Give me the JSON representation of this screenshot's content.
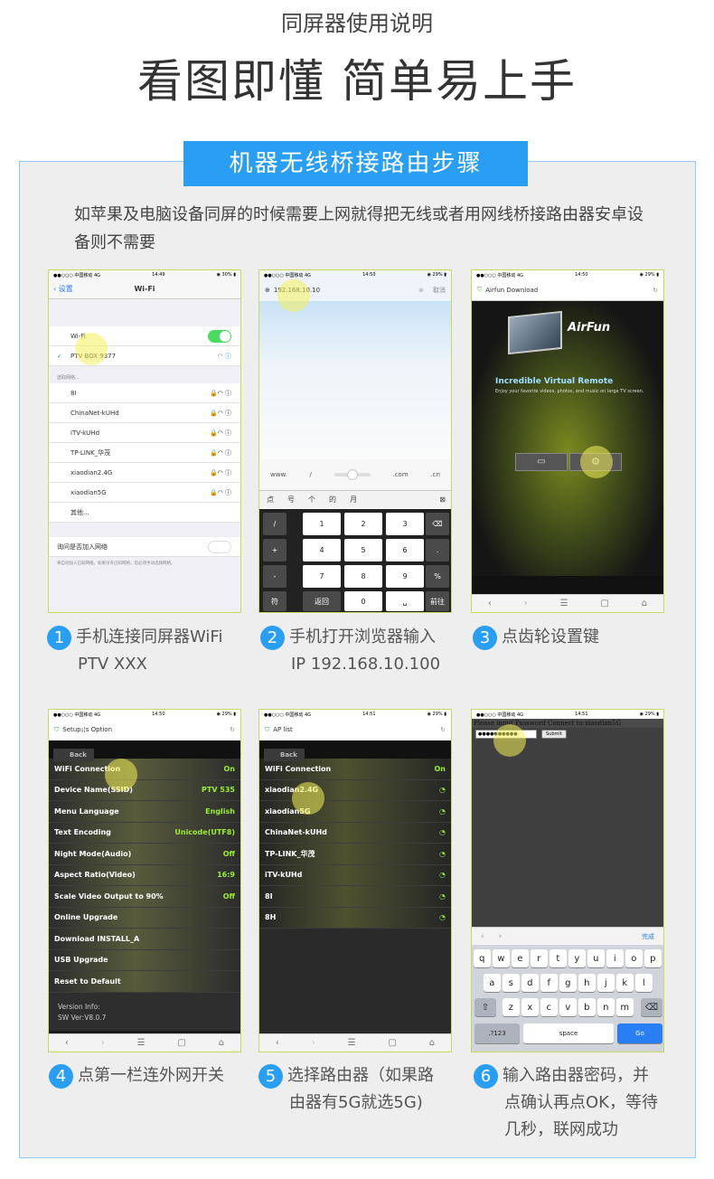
{
  "header": {
    "subtitle": "同屏器使用说明",
    "title": "看图即懂 简单易上手"
  },
  "banner": "机器无线桥接路由步骤",
  "intro": "如苹果及电脑设备同屏的时候需要上网就得把无线或者用网线桥接路由器安卓设备则不需要",
  "status": {
    "carrier": "●●○○○ 中国移动  4G",
    "t1": "14:49",
    "t2": "14:50",
    "t3": "14:50",
    "t4": "14:50",
    "t5": "14:51",
    "t6": "14:51",
    "b1": "◉ 30% ▮",
    "b2": "◉ 29% ▮"
  },
  "p1": {
    "back": "设置",
    "title": "Wi-Fi",
    "wifi": "Wi-Fi",
    "current": "PTV BOX 9377",
    "choose": "选取网络...",
    "networks": [
      "8I",
      "ChinaNet-kUHd",
      "iTV-kUHd",
      "TP-LINK_华茂",
      "xiaodian2.4G",
      "xiaodian5G",
      "其他..."
    ],
    "ask": "询问是否加入网络",
    "ask_note": "将自动加入已知网络。如果没有已知网络，您必须手动选择网络。"
  },
  "p2": {
    "url": "192.168.10.10",
    "cancel": "取消",
    "www": "www.",
    "slash": "/",
    "com": ".com",
    "cn": ".cn",
    "cands": [
      "点",
      "号",
      "个",
      "的",
      "月"
    ],
    "keys": [
      "1",
      "2",
      "3",
      "4",
      "5",
      "6",
      "7",
      "8",
      "9",
      "0"
    ],
    "sym": [
      "/",
      "+",
      "-",
      ":"
    ],
    "fu": "符",
    "back": "返回",
    "go": "前往",
    "comma": ",",
    "dot": ".",
    "pct": "%"
  },
  "p3": {
    "title": "Airfun Download",
    "brand": "AirFun",
    "headline": "Incredible Virtual Remote",
    "desc": "Enjoy your favorite videos, photos, and music on large TV screen."
  },
  "p4": {
    "title": "Setup¡¦s Option",
    "back": "Back",
    "rows": [
      [
        "WiFi Connection",
        "On"
      ],
      [
        "Device Name(SSID)",
        "PTV 535"
      ],
      [
        "Menu Language",
        "English"
      ],
      [
        "Text Encoding",
        "Unicode(UTF8)"
      ],
      [
        "Night Mode(Audio)",
        "Off"
      ],
      [
        "Aspect Ratio(Video)",
        "16:9"
      ],
      [
        "Scale Video Output to 90%",
        "Off"
      ],
      [
        "Online Upgrade",
        ""
      ],
      [
        "Download INSTALL_A",
        ""
      ],
      [
        "USB Upgrade",
        ""
      ],
      [
        "Reset to Default",
        ""
      ]
    ],
    "version_label": "Version Info:",
    "version": "SW Ver:V8.0.7"
  },
  "p5": {
    "title": "AP list",
    "back": "Back",
    "wifi": "WiFi Connection",
    "on": "On",
    "aps": [
      "xiaodian2.4G",
      "xiaodian5G",
      "ChinaNet-kUHd",
      "TP-LINK_华茂",
      "iTV-kUHd",
      "8I",
      "8H"
    ]
  },
  "p6": {
    "prompt": "Please input Password Connect to:xiaodian5G",
    "password": "●●●●●●●●●●",
    "submit": "Submit",
    "done": "完成",
    "row1": [
      "q",
      "w",
      "e",
      "r",
      "t",
      "y",
      "u",
      "i",
      "o",
      "p"
    ],
    "row2": [
      "a",
      "s",
      "d",
      "f",
      "g",
      "h",
      "j",
      "k",
      "l"
    ],
    "row3": [
      "z",
      "x",
      "c",
      "v",
      "b",
      "n",
      "m"
    ],
    "num": ".?123",
    "space": "space",
    "go": "Go"
  },
  "steps": [
    {
      "n": "1",
      "l1": "手机连接同屏器WiFi",
      "l2": "PTV XXX"
    },
    {
      "n": "2",
      "l1": "手机打开浏览器输入",
      "l2": "IP 192.168.10.100"
    },
    {
      "n": "3",
      "l1": "点齿轮设置键",
      "l2": ""
    },
    {
      "n": "4",
      "l1": "点第一栏连外网开关",
      "l2": ""
    },
    {
      "n": "5",
      "l1": "选择路由器（如果路",
      "l2": "由器有5G就选5G)"
    },
    {
      "n": "6",
      "l1": "输入路由器密码，并",
      "l2": "点确认再点OK，等待",
      "l3": "几秒，联网成功"
    }
  ],
  "colors": {
    "accent": "#2a9ef3",
    "highlight": "#f4f05a",
    "value_green": "#9cee2e"
  }
}
